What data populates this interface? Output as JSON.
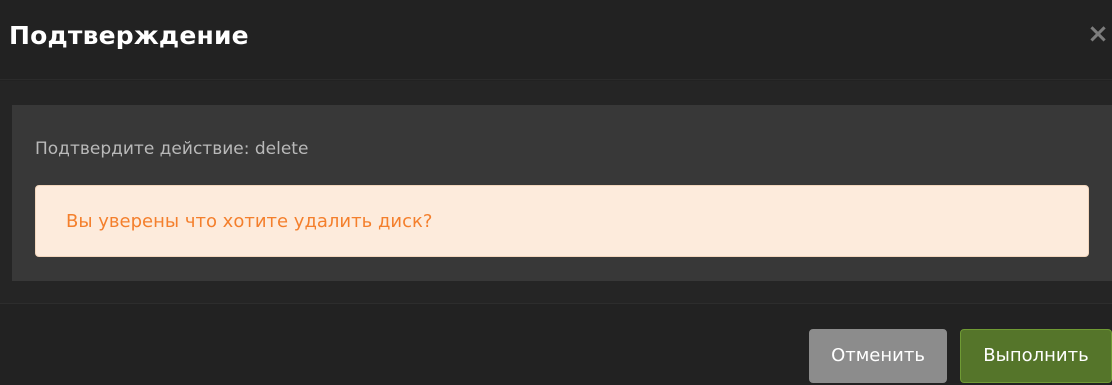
{
  "dialog": {
    "title": "Подтверждение",
    "close_icon": "close-icon",
    "close_glyph": "×"
  },
  "body": {
    "confirm_text": "Подтвердите действие: delete",
    "alert_text": "Вы уверены что хотите удалить диск?"
  },
  "footer": {
    "cancel_label": "Отменить",
    "ok_label": "Выполнить"
  },
  "colors": {
    "background": "#222222",
    "panel": "#383838",
    "alert_background": "#fdebdc",
    "alert_text": "#f47f2c",
    "cancel_button": "#8c8c8c",
    "ok_button": "#55752a"
  }
}
